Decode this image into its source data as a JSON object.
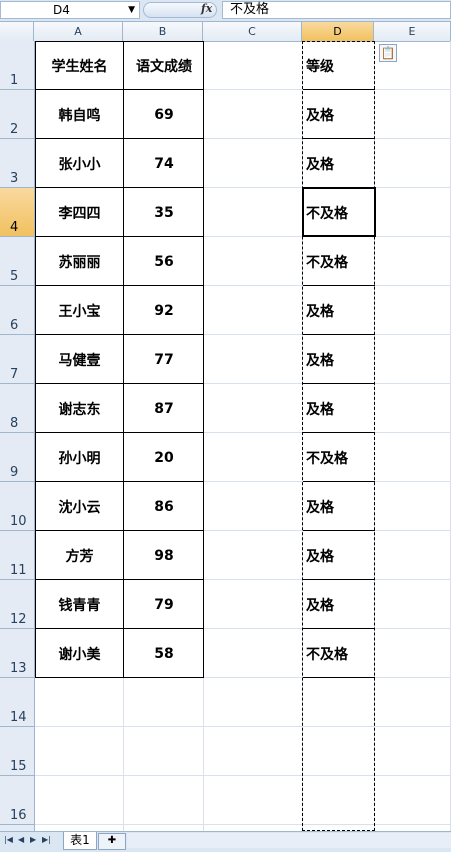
{
  "formula_bar": {
    "name_box": "D4",
    "fx_label": "fx",
    "content": "不及格"
  },
  "columns": [
    "A",
    "B",
    "C",
    "D",
    "E"
  ],
  "selected_column": "D",
  "rows": [
    "1",
    "2",
    "3",
    "4",
    "5",
    "6",
    "7",
    "8",
    "9",
    "10",
    "11",
    "12",
    "13",
    "14",
    "15",
    "16"
  ],
  "selected_row": "4",
  "table": {
    "headers": [
      "学生姓名",
      "语文成绩",
      "",
      "等级"
    ],
    "records": [
      {
        "name": "韩自鸣",
        "score": "69",
        "grade": "及格"
      },
      {
        "name": "张小小",
        "score": "74",
        "grade": "及格"
      },
      {
        "name": "李四四",
        "score": "35",
        "grade": "不及格"
      },
      {
        "name": "苏丽丽",
        "score": "56",
        "grade": "不及格"
      },
      {
        "name": "王小宝",
        "score": "92",
        "grade": "及格"
      },
      {
        "name": "马健壹",
        "score": "77",
        "grade": "及格"
      },
      {
        "name": "谢志东",
        "score": "87",
        "grade": "及格"
      },
      {
        "name": "孙小明",
        "score": "20",
        "grade": "不及格"
      },
      {
        "name": "沈小云",
        "score": "86",
        "grade": "及格"
      },
      {
        "name": "方芳",
        "score": "98",
        "grade": "及格"
      },
      {
        "name": "钱青青",
        "score": "79",
        "grade": "及格"
      },
      {
        "name": "谢小美",
        "score": "58",
        "grade": "不及格"
      }
    ]
  },
  "sheet_tabs": [
    "表1"
  ],
  "icons": {
    "name_box_dropdown": "chevron-down-icon",
    "paste_options": "clipboard-icon",
    "nav": [
      "first-sheet-icon",
      "prev-sheet-icon",
      "next-sheet-icon",
      "last-sheet-icon"
    ],
    "new_sheet": "new-sheet-icon"
  }
}
